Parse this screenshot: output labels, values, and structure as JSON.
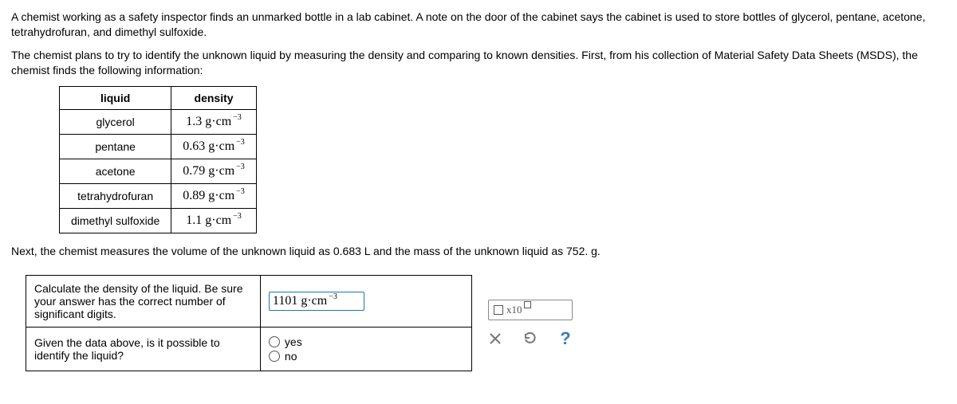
{
  "intro": {
    "p1": "A chemist working as a safety inspector finds an unmarked bottle in a lab cabinet. A note on the door of the cabinet says the cabinet is used to store bottles of glycerol, pentane, acetone, tetrahydrofuran, and dimethyl sulfoxide.",
    "p2": "The chemist plans to try to identify the unknown liquid by measuring the density and comparing to known densities. First, from his collection of Material Safety Data Sheets (MSDS), the chemist finds the following information:"
  },
  "table": {
    "headers": {
      "liquid": "liquid",
      "density": "density"
    },
    "rows": [
      {
        "liquid": "glycerol",
        "value": "1.3",
        "unit": "g·cm",
        "exp": "−3"
      },
      {
        "liquid": "pentane",
        "value": "0.63",
        "unit": "g·cm",
        "exp": "−3"
      },
      {
        "liquid": "acetone",
        "value": "0.79",
        "unit": "g·cm",
        "exp": "−3"
      },
      {
        "liquid": "tetrahydrofuran",
        "value": "0.89",
        "unit": "g·cm",
        "exp": "−3"
      },
      {
        "liquid": "dimethyl sulfoxide",
        "value": "1.1",
        "unit": "g·cm",
        "exp": "−3"
      }
    ]
  },
  "next_line": "Next, the chemist measures the volume of the unknown liquid as 0.683 L and the mass of the unknown liquid as 752. g.",
  "qa": {
    "q1": "Calculate the density of the liquid. Be sure your answer has the correct number of significant digits.",
    "a1_value": "1101",
    "a1_unit": "g·cm",
    "a1_exp": "−3",
    "q2": "Given the data above, is it possible to identify the liquid?",
    "opt_yes": "yes",
    "opt_no": "no"
  },
  "tools": {
    "sci_label": "x10",
    "help": "?"
  }
}
